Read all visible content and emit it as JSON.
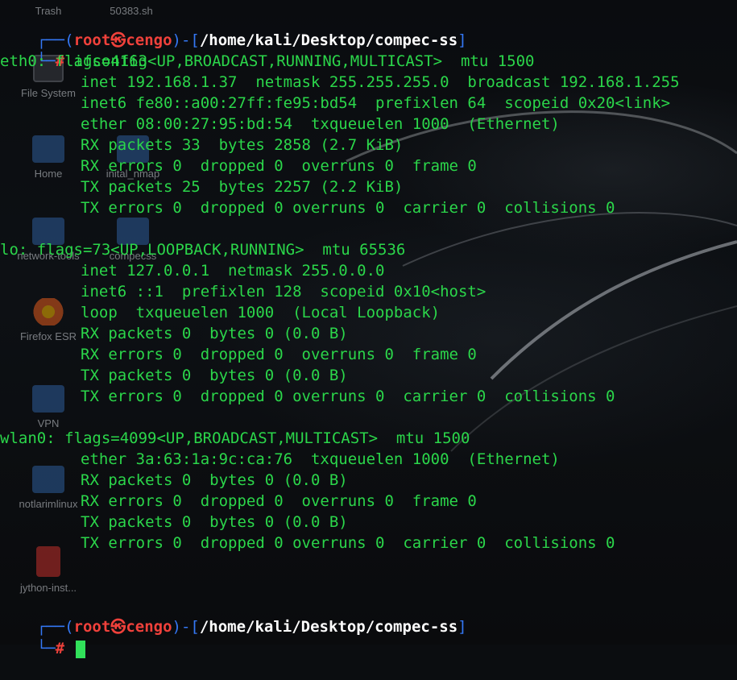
{
  "desktop": {
    "icons": [
      {
        "label": "Trash",
        "icon": "trash-icon"
      },
      {
        "label": "50383.sh",
        "icon": "script-file-icon"
      },
      {
        "label": "File System",
        "icon": "drive-icon"
      },
      {
        "label": "Home",
        "icon": "home-folder-icon"
      },
      {
        "label": "inital_nmap",
        "icon": "folder-icon"
      },
      {
        "label": "network-tools",
        "icon": "folder-icon"
      },
      {
        "label": "compecss",
        "icon": "folder-icon"
      },
      {
        "label": "Firefox ESR",
        "icon": "firefox-icon"
      },
      {
        "label": "VPN",
        "icon": "locked-folder-icon"
      },
      {
        "label": "notlarimlinux",
        "icon": "locked-folder-icon"
      },
      {
        "label": "jython-inst...",
        "icon": "java-file-icon"
      }
    ]
  },
  "prompt1": {
    "open": "┌──(",
    "user": "root",
    "symbol": "㉿",
    "host": "cengo",
    "mid": ")-[",
    "path": "/home/kali/Desktop/compec-ss",
    "close": "]",
    "second_prefix": "└─",
    "hash": "#",
    "command": "ifconfig"
  },
  "eth0": {
    "name": "eth0:",
    "flags": "flags=4163<UP,BROADCAST,RUNNING,MULTICAST>  mtu 1500",
    "lines": [
      "inet 192.168.1.37  netmask 255.255.255.0  broadcast 192.168.1.255",
      "inet6 fe80::a00:27ff:fe95:bd54  prefixlen 64  scopeid 0x20<link>",
      "ether 08:00:27:95:bd:54  txqueuelen 1000  (Ethernet)",
      "RX packets 33  bytes 2858 (2.7 KiB)",
      "RX errors 0  dropped 0  overruns 0  frame 0",
      "TX packets 25  bytes 2257 (2.2 KiB)",
      "TX errors 0  dropped 0 overruns 0  carrier 0  collisions 0"
    ]
  },
  "lo": {
    "name": "lo:",
    "flags": "flags=73<UP,LOOPBACK,RUNNING>  mtu 65536",
    "lines": [
      "inet 127.0.0.1  netmask 255.0.0.0",
      "inet6 ::1  prefixlen 128  scopeid 0x10<host>",
      "loop  txqueuelen 1000  (Local Loopback)",
      "RX packets 0  bytes 0 (0.0 B)",
      "RX errors 0  dropped 0  overruns 0  frame 0",
      "TX packets 0  bytes 0 (0.0 B)",
      "TX errors 0  dropped 0 overruns 0  carrier 0  collisions 0"
    ]
  },
  "wlan0": {
    "name": "wlan0:",
    "flags": "flags=4099<UP,BROADCAST,MULTICAST>  mtu 1500",
    "lines": [
      "ether 3a:63:1a:9c:ca:76  txqueuelen 1000  (Ethernet)",
      "RX packets 0  bytes 0 (0.0 B)",
      "RX errors 0  dropped 0  overruns 0  frame 0",
      "TX packets 0  bytes 0 (0.0 B)",
      "TX errors 0  dropped 0 overruns 0  carrier 0  collisions 0"
    ]
  },
  "prompt2": {
    "open": "┌──(",
    "user": "root",
    "symbol": "㉿",
    "host": "cengo",
    "mid": ")-[",
    "path": "/home/kali/Desktop/compec-ss",
    "close": "]",
    "second_prefix": "└─",
    "hash": "#",
    "command": ""
  },
  "colors": {
    "text_green": "#2bd64a",
    "prompt_blue": "#3478f6",
    "user_red": "#f0413b",
    "cursor_green": "#31e05a",
    "background": "#0b0d10"
  }
}
